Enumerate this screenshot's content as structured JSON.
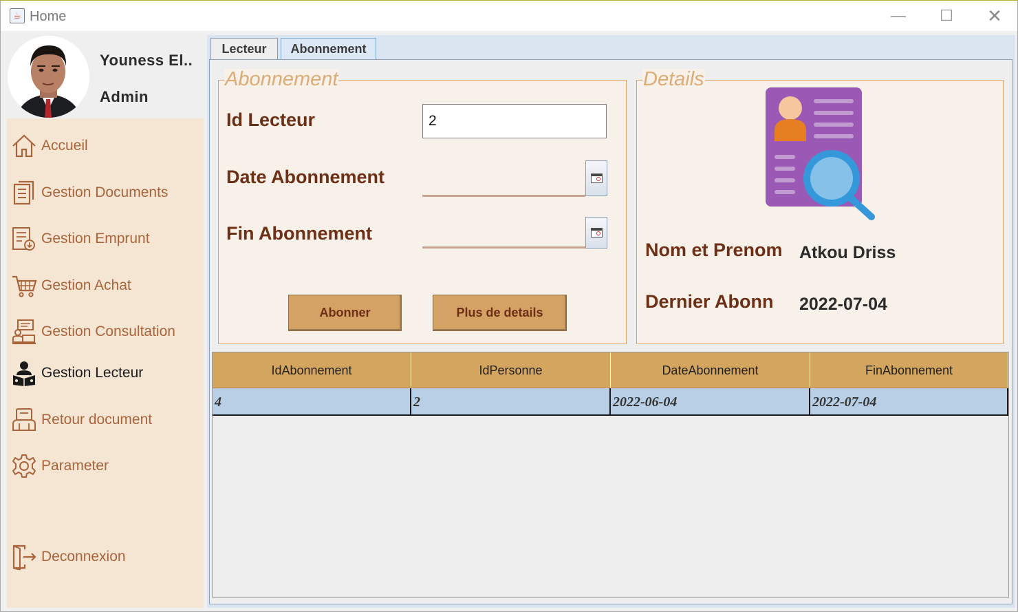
{
  "window": {
    "title": "Home",
    "app_icon": "java-cup-icon",
    "controls": [
      "minimize",
      "maximize",
      "close"
    ]
  },
  "profile": {
    "name": "Youness El..",
    "role": "Admin"
  },
  "nav": {
    "items": [
      {
        "label": "Accueil",
        "icon": "home-icon"
      },
      {
        "label": "Gestion Documents",
        "icon": "documents-icon"
      },
      {
        "label": "Gestion Emprunt",
        "icon": "loan-icon"
      },
      {
        "label": "Gestion Achat",
        "icon": "cart-icon"
      },
      {
        "label": "Gestion Consultation",
        "icon": "consultation-icon"
      },
      {
        "label": "Gestion Lecteur",
        "icon": "reader-icon",
        "active": true
      },
      {
        "label": "Retour document",
        "icon": "return-icon"
      },
      {
        "label": "Parameter",
        "icon": "gear-icon"
      },
      {
        "label": "Deconnexion",
        "icon": "logout-icon"
      }
    ]
  },
  "tabs": {
    "lecteur": "Lecteur",
    "abonnement": "Abonnement",
    "active": "Abonnement"
  },
  "abonnement_form": {
    "title": "Abonnement",
    "id_lecteur_label": "Id Lecteur",
    "id_lecteur_value": "2",
    "date_label": "Date Abonnement",
    "date_value": "",
    "fin_label": "Fin Abonnement",
    "fin_value": "",
    "btn_abonner": "Abonner",
    "btn_details": "Plus de details"
  },
  "details": {
    "title": "Details",
    "icon": "profile-search-icon",
    "nom_label": "Nom et Prenom",
    "nom_value": "Atkou Driss",
    "dernier_label": "Dernier Abonn",
    "dernier_value": "2022-07-04"
  },
  "table": {
    "columns": [
      "IdAbonnement",
      "IdPersonne",
      "DateAbonnement",
      "FinAbonnement"
    ],
    "rows": [
      [
        "4",
        "2",
        "2022-06-04",
        "2022-07-04"
      ]
    ]
  },
  "colors": {
    "sidebar_bg": "#f4e6d3",
    "accent": "#d4a264",
    "label_brown": "#6d2f15",
    "nav_text": "#a9643c",
    "row_selected": "#b8cfe5"
  }
}
